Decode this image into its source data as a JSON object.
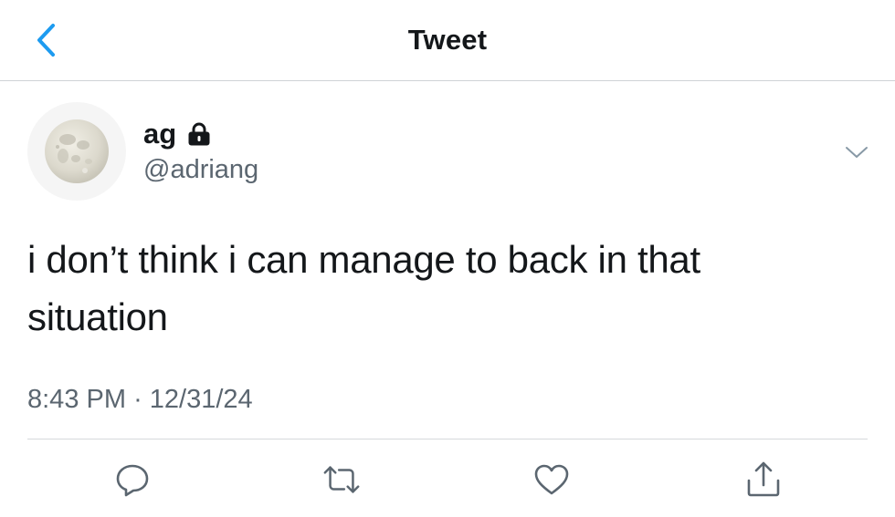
{
  "nav": {
    "title": "Tweet",
    "back_icon": "chevron-left-icon"
  },
  "author": {
    "display_name": "ag",
    "protected_icon": "lock-icon",
    "handle": "@adriang",
    "avatar": "moon-avatar"
  },
  "tweet": {
    "text": "i don’t think i can manage to back in that situation",
    "time": "8:43 PM",
    "separator": "·",
    "date": "12/31/24"
  },
  "actions": [
    {
      "name": "reply",
      "icon": "reply-icon"
    },
    {
      "name": "retweet",
      "icon": "retweet-icon"
    },
    {
      "name": "like",
      "icon": "heart-icon"
    },
    {
      "name": "share",
      "icon": "share-icon"
    }
  ],
  "colors": {
    "accent": "#1d9bf0",
    "text": "#14171a",
    "secondary": "#5b6670",
    "divider": "#cfd3d6"
  }
}
